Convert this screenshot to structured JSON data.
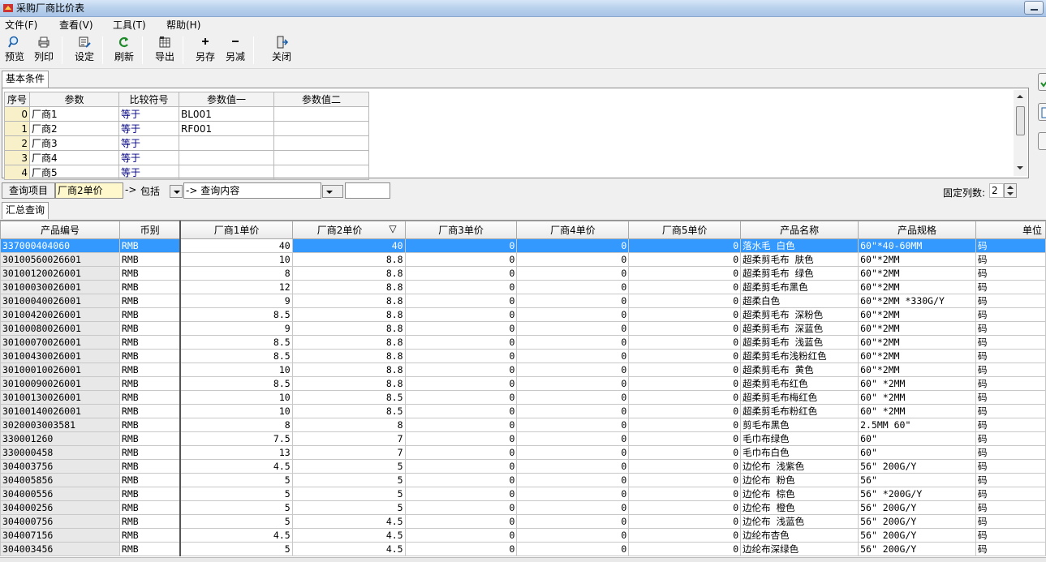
{
  "window": {
    "title": "采购厂商比价表"
  },
  "menu": [
    "文件(F)",
    "查看(V)",
    "工具(T)",
    "帮助(H)"
  ],
  "toolbar": [
    {
      "label": "预览",
      "icon": "preview-icon"
    },
    {
      "label": "列印",
      "icon": "print-icon"
    },
    {
      "label": "设定",
      "icon": "settings-icon"
    },
    {
      "label": "刷新",
      "icon": "refresh-icon"
    },
    {
      "label": "导出",
      "icon": "export-icon"
    },
    {
      "label": "另存",
      "icon": "plus-icon"
    },
    {
      "label": "另减",
      "icon": "minus-icon"
    },
    {
      "label": "关闭",
      "icon": "exit-icon"
    }
  ],
  "criteria": {
    "tab": "基本条件",
    "headers": [
      "序号",
      "参数",
      "比较符号",
      "参数值一",
      "参数值二"
    ],
    "rows": [
      [
        "0",
        "厂商1",
        "等于",
        "BL001",
        ""
      ],
      [
        "1",
        "厂商2",
        "等于",
        "RF001",
        ""
      ],
      [
        "2",
        "厂商3",
        "等于",
        "",
        ""
      ],
      [
        "3",
        "厂商4",
        "等于",
        "",
        ""
      ],
      [
        "4",
        "厂商5",
        "等于",
        "",
        ""
      ]
    ]
  },
  "query": {
    "label": "查询项目",
    "field": "厂商2单价",
    "arrow1": "->",
    "op": "包括",
    "arrow2": "->",
    "content_placeholder": "查询内容",
    "fixed_cols_label": "固定列数:",
    "fixed_cols_value": "2"
  },
  "summary": {
    "tab": "汇总查询",
    "headers": [
      "产品编号",
      "币别",
      "厂商1单价",
      "厂商2单价",
      "厂商3单价",
      "厂商4单价",
      "厂商5单价",
      "产品名称",
      "产品规格",
      "单位"
    ],
    "sorted_glyph": "▽",
    "rows": [
      [
        "337000404060",
        "RMB",
        "40",
        "40",
        "0",
        "0",
        "0",
        "落水毛 白色",
        "60\"*40-60MM",
        "码"
      ],
      [
        "30100560026601",
        "RMB",
        "10",
        "8.8",
        "0",
        "0",
        "0",
        "超柔剪毛布 肤色",
        "60\"*2MM",
        "码"
      ],
      [
        "30100120026001",
        "RMB",
        "8",
        "8.8",
        "0",
        "0",
        "0",
        "超柔剪毛布 绿色",
        "60\"*2MM",
        "码"
      ],
      [
        "30100030026001",
        "RMB",
        "12",
        "8.8",
        "0",
        "0",
        "0",
        "超柔剪毛布黑色",
        "60\"*2MM",
        "码"
      ],
      [
        "30100040026001",
        "RMB",
        "9",
        "8.8",
        "0",
        "0",
        "0",
        "超柔白色",
        "60\"*2MM *330G/Y",
        "码"
      ],
      [
        "30100420026001",
        "RMB",
        "8.5",
        "8.8",
        "0",
        "0",
        "0",
        "超柔剪毛布 深粉色",
        "60\"*2MM",
        "码"
      ],
      [
        "30100080026001",
        "RMB",
        "9",
        "8.8",
        "0",
        "0",
        "0",
        "超柔剪毛布 深蓝色",
        "60\"*2MM",
        "码"
      ],
      [
        "30100070026001",
        "RMB",
        "8.5",
        "8.8",
        "0",
        "0",
        "0",
        "超柔剪毛布 浅蓝色",
        "60\"*2MM",
        "码"
      ],
      [
        "30100430026001",
        "RMB",
        "8.5",
        "8.8",
        "0",
        "0",
        "0",
        "超柔剪毛布浅粉红色",
        "60\"*2MM",
        "码"
      ],
      [
        "30100010026001",
        "RMB",
        "10",
        "8.8",
        "0",
        "0",
        "0",
        "超柔剪毛布 黄色",
        "60\"*2MM",
        "码"
      ],
      [
        "30100090026001",
        "RMB",
        "8.5",
        "8.8",
        "0",
        "0",
        "0",
        "超柔剪毛布红色",
        "60\" *2MM",
        "码"
      ],
      [
        "30100130026001",
        "RMB",
        "10",
        "8.5",
        "0",
        "0",
        "0",
        "超柔剪毛布梅红色",
        "60\" *2MM",
        "码"
      ],
      [
        "30100140026001",
        "RMB",
        "10",
        "8.5",
        "0",
        "0",
        "0",
        "超柔剪毛布粉红色",
        "60\" *2MM",
        "码"
      ],
      [
        "3020003003581",
        "RMB",
        "8",
        "8",
        "0",
        "0",
        "0",
        "剪毛布黑色",
        "2.5MM  60\"",
        "码"
      ],
      [
        "330001260",
        "RMB",
        "7.5",
        "7",
        "0",
        "0",
        "0",
        "毛巾布绿色",
        "60\"",
        "码"
      ],
      [
        "330000458",
        "RMB",
        "13",
        "7",
        "0",
        "0",
        "0",
        "毛巾布白色",
        "60\"",
        "码"
      ],
      [
        "304003756",
        "RMB",
        "4.5",
        "5",
        "0",
        "0",
        "0",
        "边伦布 浅紫色",
        "56\" 200G/Y",
        "码"
      ],
      [
        "304005856",
        "RMB",
        "5",
        "5",
        "0",
        "0",
        "0",
        "边伦布 粉色",
        "56\"",
        "码"
      ],
      [
        "304000556",
        "RMB",
        "5",
        "5",
        "0",
        "0",
        "0",
        "边伦布 棕色",
        "56\" *200G/Y",
        "码"
      ],
      [
        "304000256",
        "RMB",
        "5",
        "5",
        "0",
        "0",
        "0",
        "边伦布 橙色",
        "56\" 200G/Y",
        "码"
      ],
      [
        "304000756",
        "RMB",
        "5",
        "4.5",
        "0",
        "0",
        "0",
        "边伦布 浅蓝色",
        "56\" 200G/Y",
        "码"
      ],
      [
        "304007156",
        "RMB",
        "4.5",
        "4.5",
        "0",
        "0",
        "0",
        "边纶布杏色",
        "56\" 200G/Y",
        "码"
      ],
      [
        "304003456",
        "RMB",
        "5",
        "4.5",
        "0",
        "0",
        "0",
        "边纶布深绿色",
        "56\" 200G/Y",
        "码"
      ]
    ]
  }
}
